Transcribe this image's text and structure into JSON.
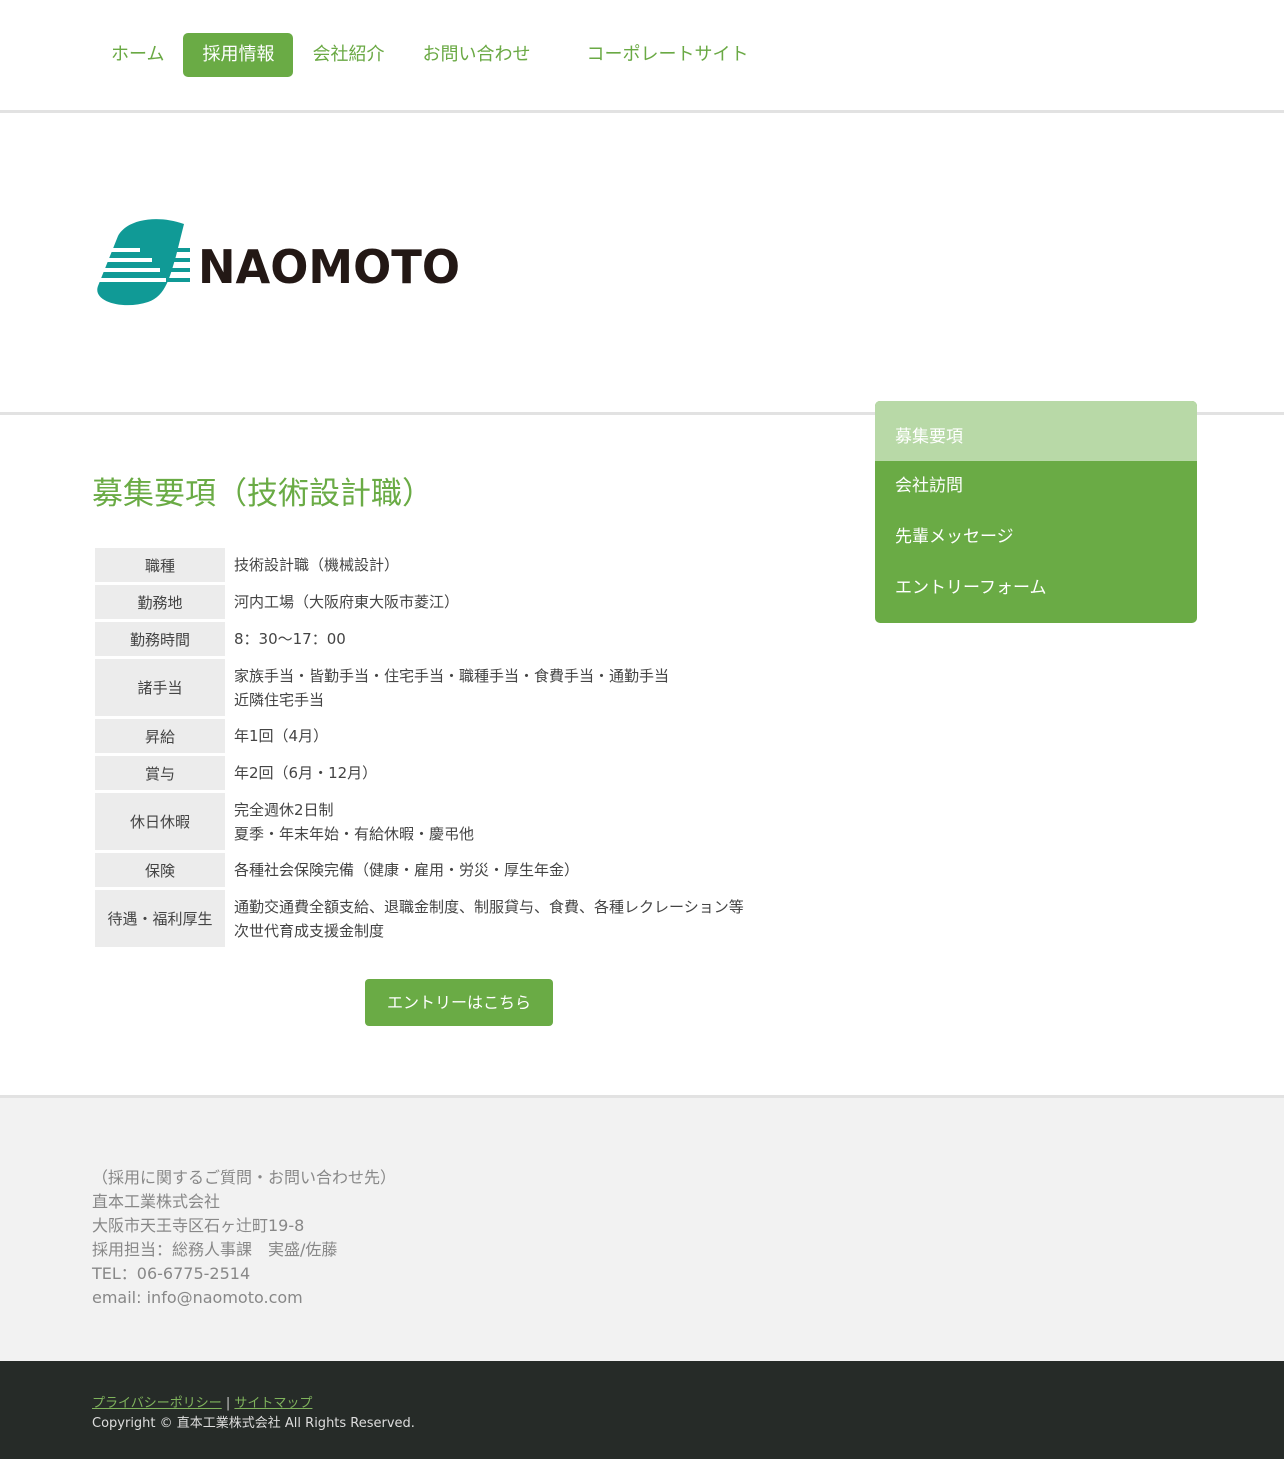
{
  "nav": {
    "items": [
      {
        "label": "ホーム",
        "active": false
      },
      {
        "label": "採用情報",
        "active": true
      },
      {
        "label": "会社紹介",
        "active": false
      },
      {
        "label": "お問い合わせ",
        "active": false
      },
      {
        "label": "コーポレートサイト",
        "active": false
      }
    ]
  },
  "logo": {
    "text": "NAOMOTO",
    "colors": {
      "mark": "#109a96",
      "text": "#231815"
    }
  },
  "side_menu": {
    "items": [
      "募集要項",
      "会社訪問",
      "先輩メッセージ",
      "エントリーフォーム"
    ]
  },
  "main": {
    "title": "募集要項（技術設計職）",
    "rows": [
      {
        "label": "職種",
        "lines": [
          "技術設計職（機械設計）"
        ]
      },
      {
        "label": "勤務地",
        "lines": [
          "河内工場（大阪府東大阪市菱江）"
        ]
      },
      {
        "label": "勤務時間",
        "lines": [
          "8：30〜17：00"
        ]
      },
      {
        "label": "諸手当",
        "lines": [
          "家族手当・皆勤手当・住宅手当・職種手当・食費手当・通勤手当",
          "近隣住宅手当"
        ]
      },
      {
        "label": "昇給",
        "lines": [
          "年1回（4月）"
        ]
      },
      {
        "label": "賞与",
        "lines": [
          "年2回（6月・12月）"
        ]
      },
      {
        "label": "休日休暇",
        "lines": [
          "完全週休2日制",
          "夏季・年末年始・有給休暇・慶弔他"
        ]
      },
      {
        "label": "保険",
        "lines": [
          "各種社会保険完備（健康・雇用・労災・厚生年金）"
        ]
      },
      {
        "label": "待遇・福利厚生",
        "lines": [
          "通勤交通費全額支給、退職金制度、制服貸与、食費、各種レクレーション等",
          "次世代育成支援金制度"
        ]
      }
    ],
    "entry_button": "エントリーはこちら"
  },
  "contact": {
    "lines": [
      "（採用に関するご質問・お問い合わせ先）",
      "直本工業株式会社",
      "大阪市天王寺区石ヶ辻町19-8",
      "採用担当：総務人事課　実盛/佐藤",
      "TEL：06-6775-2514",
      "email: info@naomoto.com"
    ]
  },
  "footer": {
    "privacy": "プライバシーポリシー",
    "separator": "|",
    "sitemap": "サイトマップ",
    "copyright": "Copyright © 直本工業株式会社 All Rights Reserved."
  },
  "colors": {
    "accent": "#6aab45",
    "accent_light": "#b8d9a7",
    "footer_dark": "#262b28"
  }
}
